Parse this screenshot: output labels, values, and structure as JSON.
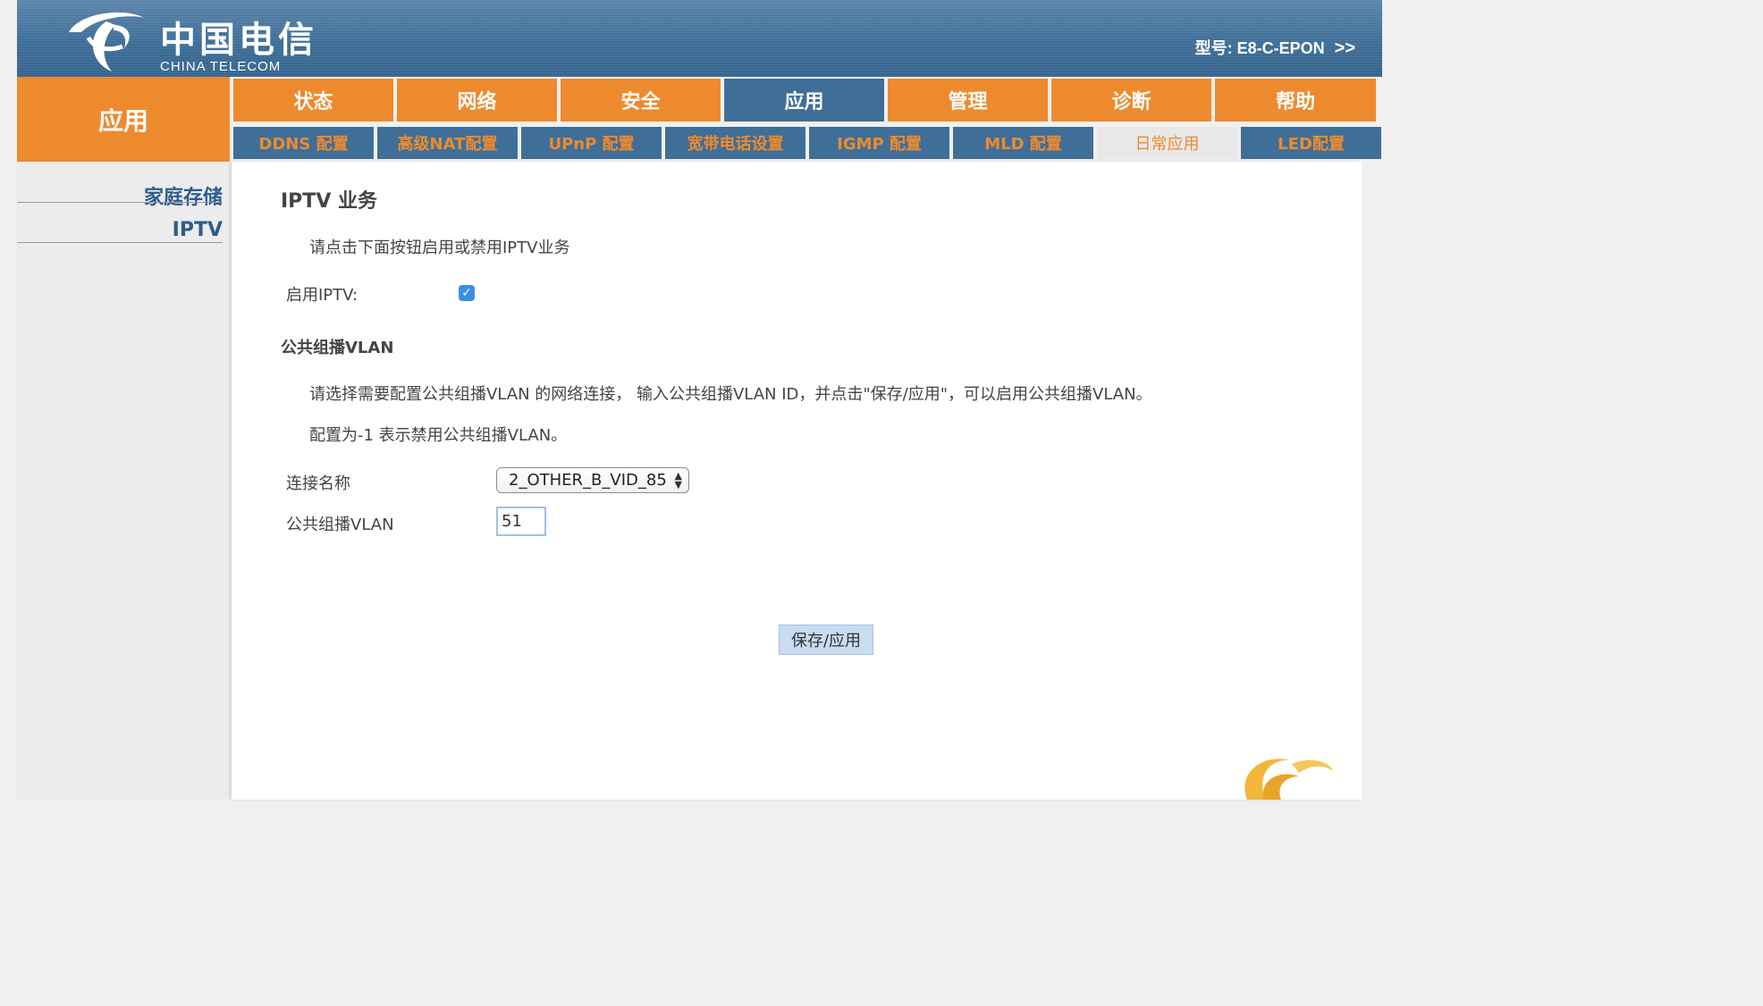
{
  "header": {
    "logo_cn": "中国电信",
    "logo_en": "CHINA TELECOM",
    "model_label": "型号:",
    "model_value": "E8-C-EPON",
    "model_arrow": ">>"
  },
  "section_title": "应用",
  "top_nav": [
    {
      "label": "状态"
    },
    {
      "label": "网络"
    },
    {
      "label": "安全"
    },
    {
      "label": "应用",
      "active": true
    },
    {
      "label": "管理"
    },
    {
      "label": "诊断"
    },
    {
      "label": "帮助"
    }
  ],
  "sub_nav": [
    {
      "label": "DDNS 配置"
    },
    {
      "label": "高级NAT配置"
    },
    {
      "label": "UPnP 配置"
    },
    {
      "label": "宽带电话设置"
    },
    {
      "label": "IGMP 配置"
    },
    {
      "label": "MLD 配置"
    },
    {
      "label": "日常应用",
      "active": true
    },
    {
      "label": "LED配置"
    }
  ],
  "sidebar": {
    "items": [
      {
        "label": "家庭存储"
      },
      {
        "label": "IPTV"
      }
    ]
  },
  "main": {
    "title": "IPTV 业务",
    "intro": "请点击下面按钮启用或禁用IPTV业务",
    "enable_label": "启用IPTV:",
    "enable_checked": true,
    "vlan_section_title": "公共组播VLAN",
    "vlan_desc_1": "请选择需要配置公共组播VLAN 的网络连接， 输入公共组播VLAN ID，并点击\"保存/应用\"，可以启用公共组播VLAN。",
    "vlan_desc_2": "配置为-1 表示禁用公共组播VLAN。",
    "connection_label": "连接名称",
    "connection_value": "2_OTHER_B_VID_85",
    "vlan_label": "公共组播VLAN",
    "vlan_value": "51",
    "save_button": "保存/应用"
  },
  "colors": {
    "accent_orange": "#ee8a2e",
    "brand_blue": "#3f6f98",
    "link_blue": "#2c5c8e"
  }
}
